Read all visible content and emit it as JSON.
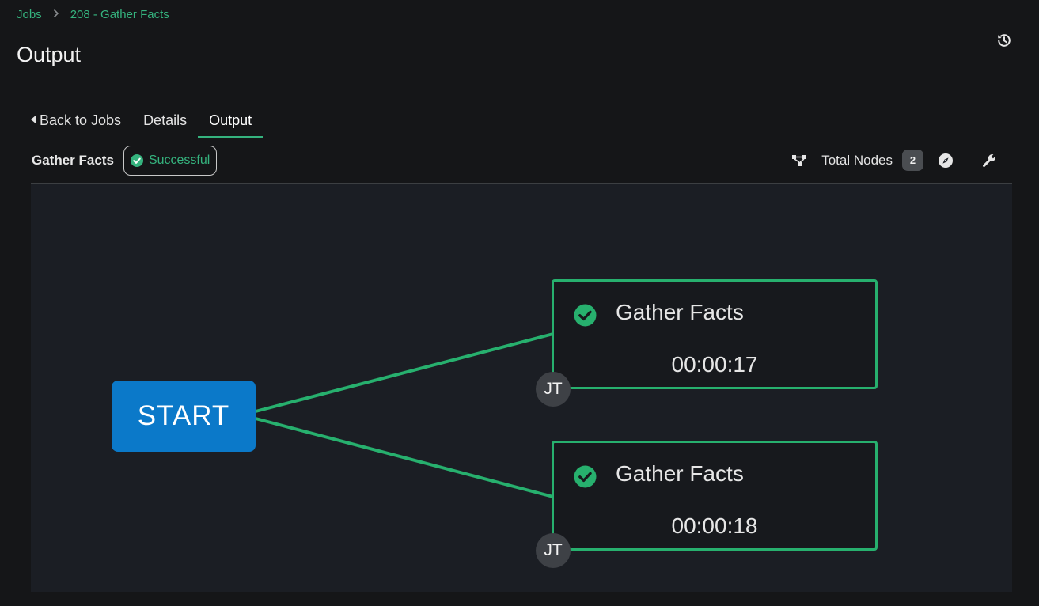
{
  "breadcrumb": {
    "items": [
      "Jobs",
      "208 - Gather Facts"
    ]
  },
  "page": {
    "title": "Output"
  },
  "tabs": [
    {
      "label": "Back to Jobs",
      "active": false
    },
    {
      "label": "Details",
      "active": false
    },
    {
      "label": "Output",
      "active": true
    }
  ],
  "toolbar": {
    "job_name": "Gather Facts",
    "status": "Successful",
    "total_nodes_label": "Total Nodes",
    "total_nodes_count": "2",
    "icons": [
      "workflow-icon",
      "compass-icon",
      "wrench-icon",
      "history-icon"
    ]
  },
  "graph": {
    "start_label": "START",
    "nodes": [
      {
        "title": "Gather Facts",
        "elapsed": "00:00:17",
        "type_badge": "JT",
        "status": "successful"
      },
      {
        "title": "Gather Facts",
        "elapsed": "00:00:18",
        "type_badge": "JT",
        "status": "successful"
      }
    ]
  },
  "colors": {
    "accent_green": "#35b37e",
    "start_blue": "#0b79c9",
    "background": "#151618",
    "canvas": "#1b1e24"
  }
}
